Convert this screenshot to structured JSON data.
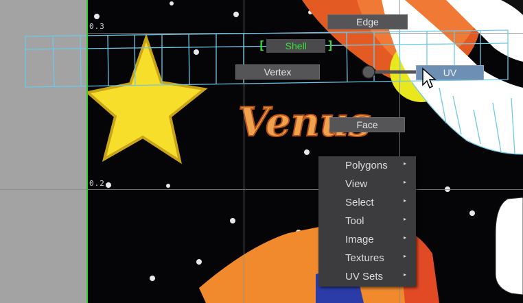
{
  "axis": {
    "label_top": "0.3",
    "label_mid": "0.2"
  },
  "artwork": {
    "text": "Venus"
  },
  "hotbox": {
    "edge": "Edge",
    "shell": "Shell",
    "shell_bracket_left": "[",
    "shell_bracket_right": "]",
    "vertex": "Vertex",
    "uv": "UV",
    "face": "Face"
  },
  "context_menu": {
    "items": [
      {
        "label": "Polygons",
        "arrow": "▸"
      },
      {
        "label": "View",
        "arrow": "▸"
      },
      {
        "label": "Select",
        "arrow": "▸"
      },
      {
        "label": "Tool",
        "arrow": "▸"
      },
      {
        "label": "Image",
        "arrow": "▸"
      },
      {
        "label": "Textures",
        "arrow": "▸"
      },
      {
        "label": "UV Sets",
        "arrow": "▸"
      }
    ]
  },
  "colors": {
    "active_item": "#6e8fb4",
    "shell_text": "#3ae03a",
    "uv_wireframe": "#6fc8e8",
    "background_panel": "#a3a3a3"
  }
}
